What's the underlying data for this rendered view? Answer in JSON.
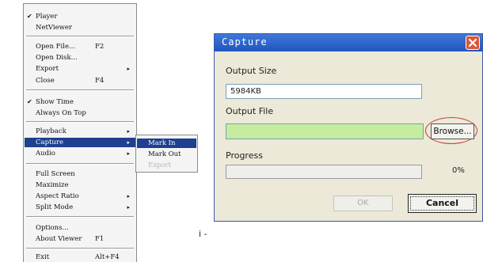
{
  "menu": {
    "items": [
      {
        "checked": true,
        "label": "Player",
        "shortcut": "",
        "submenu": false
      },
      {
        "checked": false,
        "label": "NetViewer",
        "shortcut": "",
        "submenu": false
      },
      {
        "checked": false,
        "label": "Open File...",
        "shortcut": "F2",
        "submenu": false
      },
      {
        "checked": false,
        "label": "Open Disk...",
        "shortcut": "",
        "submenu": false
      },
      {
        "checked": false,
        "label": "Export",
        "shortcut": "",
        "submenu": true
      },
      {
        "checked": false,
        "label": "Close",
        "shortcut": "F4",
        "submenu": false
      },
      {
        "checked": true,
        "label": "Show Time",
        "shortcut": "",
        "submenu": false
      },
      {
        "checked": false,
        "label": "Always On Top",
        "shortcut": "",
        "submenu": false
      },
      {
        "checked": false,
        "label": "Playback",
        "shortcut": "",
        "submenu": true
      },
      {
        "checked": false,
        "label": "Capture",
        "shortcut": "",
        "submenu": true,
        "highlighted": true
      },
      {
        "checked": false,
        "label": "Audio",
        "shortcut": "",
        "submenu": true
      },
      {
        "checked": false,
        "label": "Full Screen",
        "shortcut": "",
        "submenu": false
      },
      {
        "checked": false,
        "label": "Maximize",
        "shortcut": "",
        "submenu": false
      },
      {
        "checked": false,
        "label": "Aspect Ratio",
        "shortcut": "",
        "submenu": true
      },
      {
        "checked": false,
        "label": "Split Mode",
        "shortcut": "",
        "submenu": true
      },
      {
        "checked": false,
        "label": "Options...",
        "shortcut": "",
        "submenu": false
      },
      {
        "checked": false,
        "label": "About Viewer",
        "shortcut": "F1",
        "submenu": false
      },
      {
        "checked": false,
        "label": "Exit",
        "shortcut": "Alt+F4",
        "submenu": false
      }
    ],
    "check_glyph": "✔",
    "submenu_arrow": "▸"
  },
  "capture_submenu": {
    "items": [
      {
        "label": "Mark In",
        "state": "highlighted"
      },
      {
        "label": "Mark Out",
        "state": "normal"
      },
      {
        "label": "Export",
        "state": "disabled"
      }
    ]
  },
  "stray_text": "i -",
  "dialog": {
    "title": "Capture",
    "output_size_label": "Output Size",
    "output_size_value": "5984KB",
    "output_file_label": "Output File",
    "output_file_value": "",
    "browse_label": "Browse...",
    "progress_label": "Progress",
    "progress_fraction": 0,
    "progress_text": "0%",
    "ok_label": "OK",
    "cancel_label": "Cancel",
    "colors": {
      "titlebar": "#2a62c9",
      "close_button": "#d9573a",
      "file_field_bg": "#c6ec9e",
      "highlight_ring": "#c8383a",
      "menu_highlight": "#1f3f8f"
    }
  }
}
